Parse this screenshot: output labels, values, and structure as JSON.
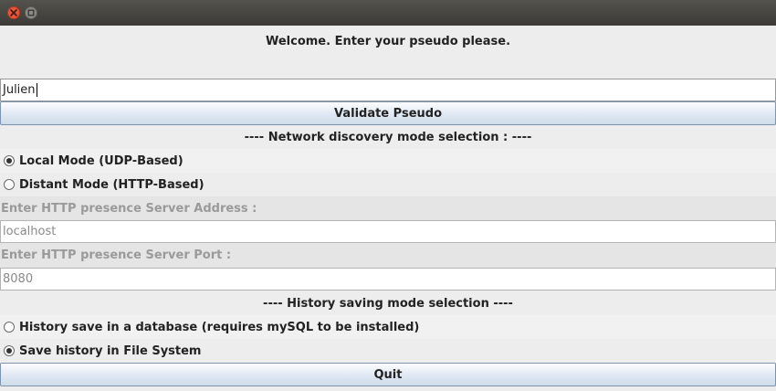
{
  "window": {
    "close_icon": "close-icon",
    "maximize_icon": "maximize-icon"
  },
  "welcome": {
    "text": "Welcome. Enter your pseudo please."
  },
  "pseudo": {
    "value": "Julien"
  },
  "validate": {
    "label": "Validate Pseudo"
  },
  "network": {
    "header": "---- Network discovery mode selection : ----",
    "options": [
      {
        "label": "Local Mode (UDP-Based)",
        "checked": true
      },
      {
        "label": "Distant Mode (HTTP-Based)",
        "checked": false
      }
    ],
    "address_label": "Enter HTTP presence Server Address :",
    "address_value": "localhost",
    "port_label": "Enter HTTP presence Server Port :",
    "port_value": "8080"
  },
  "history": {
    "header": "---- History saving mode selection ----",
    "options": [
      {
        "label": "History save in a database (requires mySQL to be installed)",
        "checked": false
      },
      {
        "label": "Save history in File System",
        "checked": true
      }
    ]
  },
  "quit": {
    "label": "Quit"
  }
}
